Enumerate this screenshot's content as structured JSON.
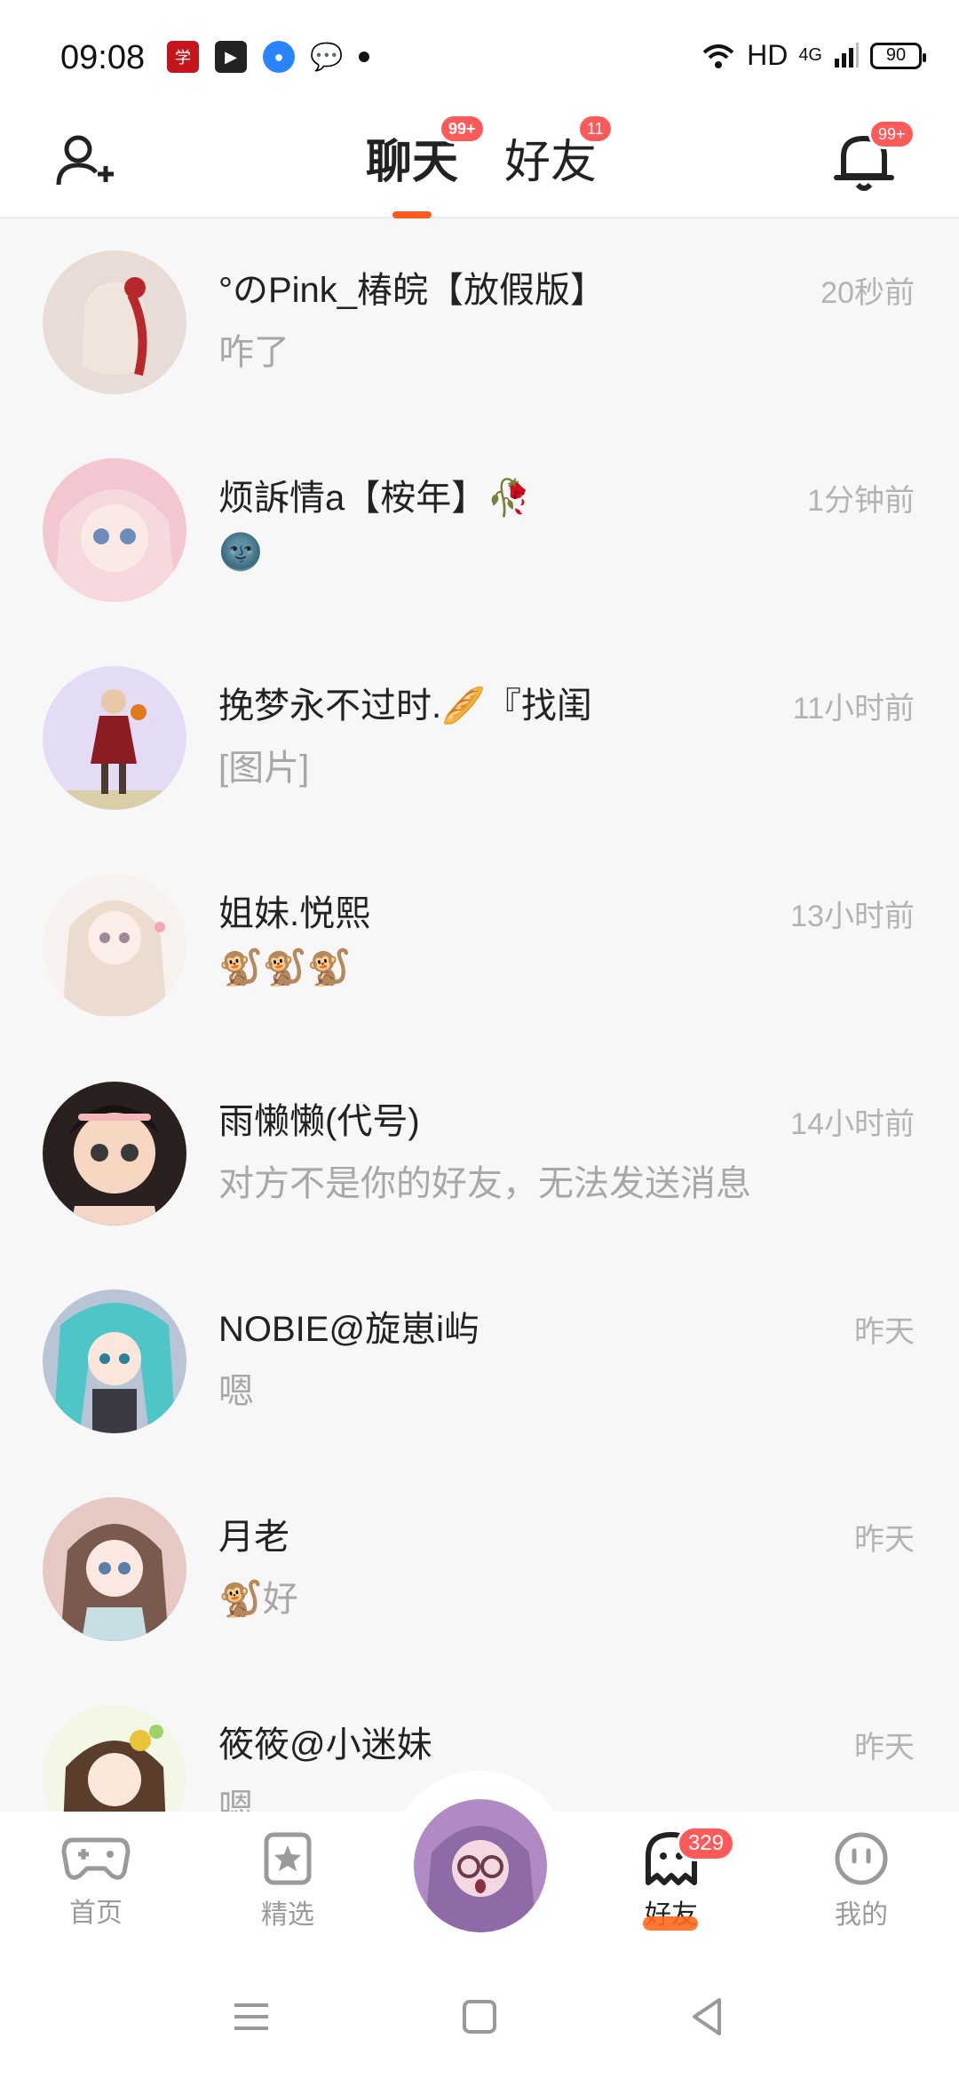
{
  "status_bar": {
    "time": "09:08",
    "network": "HD",
    "signal": "4G",
    "battery": "90"
  },
  "header": {
    "tabs": [
      {
        "label": "聊天",
        "badge": "99+",
        "active": true
      },
      {
        "label": "好友",
        "badge": "11",
        "active": false
      }
    ],
    "bell_badge": "99+",
    "accent_color": "#ff5a1f",
    "badge_color": "#ff5a5a"
  },
  "conversations": [
    {
      "name": "°のPink_椿皖【放假版】",
      "message": "咋了",
      "time": "20秒前"
    },
    {
      "name": "烦訴情a【桉年】🥀",
      "message": "🌚",
      "time": "1分钟前"
    },
    {
      "name": "挽梦永不过时.🥖『找闺",
      "message": "[图片]",
      "time": "11小时前"
    },
    {
      "name": "姐妹.悦熙",
      "message": "🐒🐒🐒",
      "time": "13小时前"
    },
    {
      "name": "雨懒懒(代号)",
      "message": "对方不是你的好友，无法发送消息",
      "time": "14小时前"
    },
    {
      "name": "NOBIE@旋崽i屿",
      "message": "嗯",
      "time": "昨天"
    },
    {
      "name": "月老",
      "message": "🐒好",
      "time": "昨天"
    },
    {
      "name": "筱筱@小迷妹",
      "message": "嗯",
      "time": "昨天"
    }
  ],
  "bottom_nav": {
    "items": [
      {
        "label": "首页",
        "icon": "gamepad-icon"
      },
      {
        "label": "精选",
        "icon": "star-bookmark-icon"
      },
      {
        "label": "好友",
        "icon": "ghost-icon",
        "badge": "329",
        "active": true
      },
      {
        "label": "我的",
        "icon": "face-icon"
      }
    ]
  }
}
